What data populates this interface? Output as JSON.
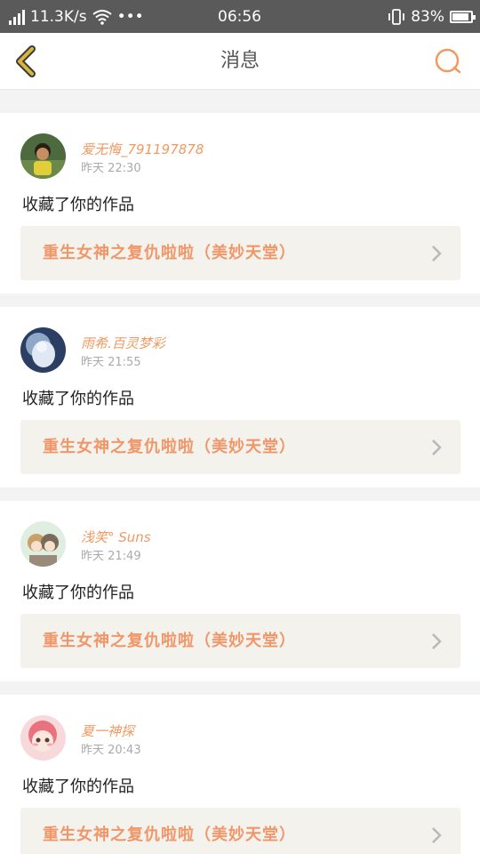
{
  "status_bar": {
    "speed": "11.3K/s",
    "dots": "•••",
    "time": "06:56",
    "battery": "83%"
  },
  "header": {
    "title": "消息"
  },
  "colors": {
    "accent": "#f09a62",
    "back_arrow": "#d9b53a",
    "card_link_bg": "#f3f2ec"
  },
  "notifications": [
    {
      "user": "爱无悔_791197878",
      "time": "昨天 22:30",
      "action": "收藏了你的作品",
      "work": "重生女神之复仇啦啦（美妙天堂）"
    },
    {
      "user": "雨希.百灵梦彩",
      "time": "昨天 21:55",
      "action": "收藏了你的作品",
      "work": "重生女神之复仇啦啦（美妙天堂）"
    },
    {
      "user": "浅笑° Suns",
      "time": "昨天 21:49",
      "action": "收藏了你的作品",
      "work": "重生女神之复仇啦啦（美妙天堂）"
    },
    {
      "user": "夏一神探",
      "time": "昨天 20:43",
      "action": "收藏了你的作品",
      "work": "重生女神之复仇啦啦（美妙天堂）"
    }
  ]
}
